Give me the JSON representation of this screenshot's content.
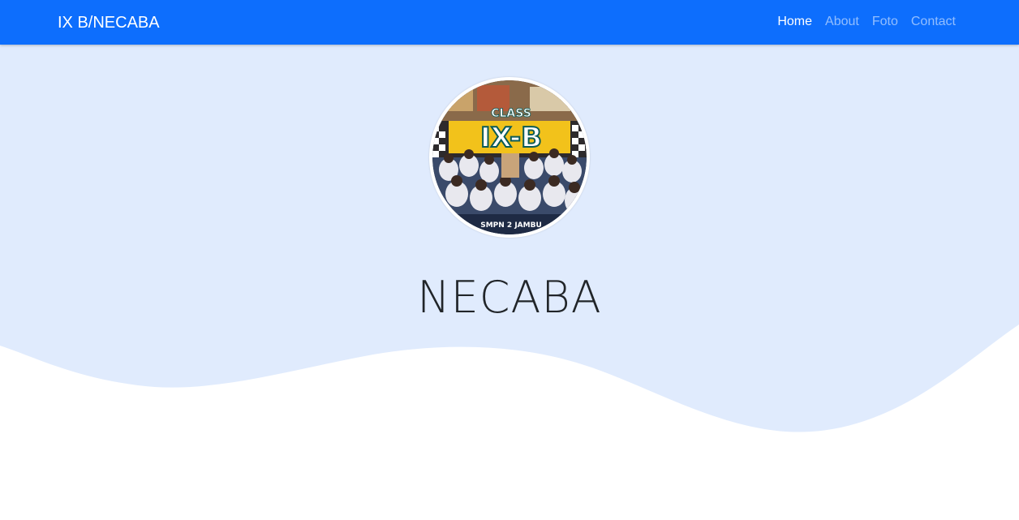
{
  "navbar": {
    "brand": "IX B/NECABA",
    "links": [
      {
        "label": "Home",
        "active": true
      },
      {
        "label": "About",
        "active": false
      },
      {
        "label": "Foto",
        "active": false
      },
      {
        "label": "Contact",
        "active": false
      }
    ]
  },
  "hero": {
    "title": "NECABA",
    "avatar": {
      "overlay_top": "CLASS",
      "overlay_main": "IX-B",
      "overlay_bottom": "SMPN 2 JAMBU"
    },
    "colors": {
      "nav_bg": "#0d6efd",
      "hero_bg": "#e0ebfd",
      "page_bg": "#ffffff"
    }
  }
}
